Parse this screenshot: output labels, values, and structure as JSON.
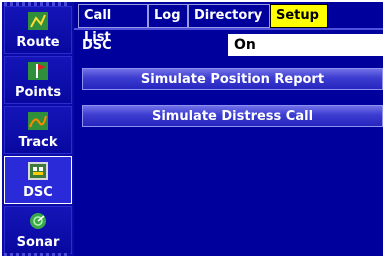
{
  "sidebar": {
    "items": [
      {
        "label": "Route",
        "icon": "route-icon"
      },
      {
        "label": "Points",
        "icon": "points-icon"
      },
      {
        "label": "Track",
        "icon": "track-icon"
      },
      {
        "label": "DSC",
        "icon": "dsc-icon",
        "active": true
      },
      {
        "label": "Sonar",
        "icon": "sonar-icon"
      }
    ]
  },
  "tabs": [
    {
      "label": "Call List"
    },
    {
      "label": "Log"
    },
    {
      "label": "Directory"
    },
    {
      "label": "Setup",
      "active": true
    }
  ],
  "dsc": {
    "label": "DSC",
    "value": "On"
  },
  "buttons": {
    "simulate_position": "Simulate Position Report",
    "simulate_distress": "Simulate Distress Call"
  },
  "colors": {
    "background": "#00009c",
    "active_tab": "#ffff00",
    "field": "#ffffff"
  }
}
